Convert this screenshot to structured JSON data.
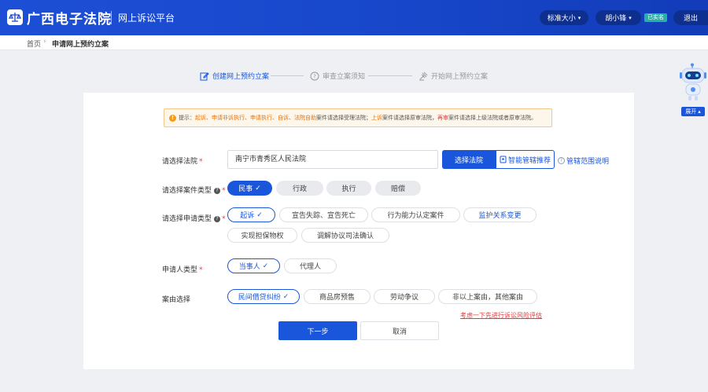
{
  "header": {
    "brand": "广西电子法院",
    "platform": "网上诉讼平台",
    "font_size_label": "标准大小",
    "user_name": "胡小锋",
    "verified": "已实名",
    "logout": "退出"
  },
  "breadcrumb": {
    "home": "首页",
    "current": "申请网上预约立案"
  },
  "steps": [
    {
      "label": "创建网上预约立案",
      "icon": "edit-icon",
      "active": true
    },
    {
      "label": "审查立案须知",
      "icon": "question-circle-icon",
      "active": false
    },
    {
      "label": "开始网上预约立案",
      "icon": "gavel-icon",
      "active": false
    }
  ],
  "notice": {
    "prefix": "提示：",
    "part1": "起诉、申请非诉执行、申请执行、自诉、法院自助",
    "part2": "案件请选择受理法院；",
    "part3": "上诉",
    "part4": "案件请选择原审法院，",
    "part5": "再审",
    "part6": "案件请选择上级法院或者原审法院。"
  },
  "form": {
    "court_label": "请选择法院",
    "court_value": "南宁市青秀区人民法院",
    "select_court_button": "选择法院",
    "smart_button": "智能管辖推荐",
    "scope_link": "管辖范围说明",
    "case_type_label": "请选择案件类型",
    "case_types": [
      "民事",
      "行政",
      "执行",
      "赔偿"
    ],
    "apply_type_label": "请选择申请类型",
    "apply_types": [
      "起诉",
      "宣告失踪、宣告死亡",
      "行为能力认定案件",
      "监护关系变更",
      "实现担保物权",
      "调解协议司法确认"
    ],
    "applicant_label": "申请人类型",
    "applicant_types": [
      "当事人",
      "代理人"
    ],
    "cause_label": "案由选择",
    "causes": [
      "民间借贷纠纷",
      "商品房预售",
      "劳动争议",
      "非以上案由，其他案由"
    ],
    "required_mark": "*",
    "risk_link": "考虑一下先进行诉讼风险评估",
    "next_button": "下一步",
    "cancel_button": "取消"
  },
  "sidebar": {
    "expand": "展开"
  },
  "colors": {
    "primary": "#1a56db",
    "header": "#1d4fd6",
    "warning": "#e8710a",
    "danger": "#e23b3b"
  }
}
